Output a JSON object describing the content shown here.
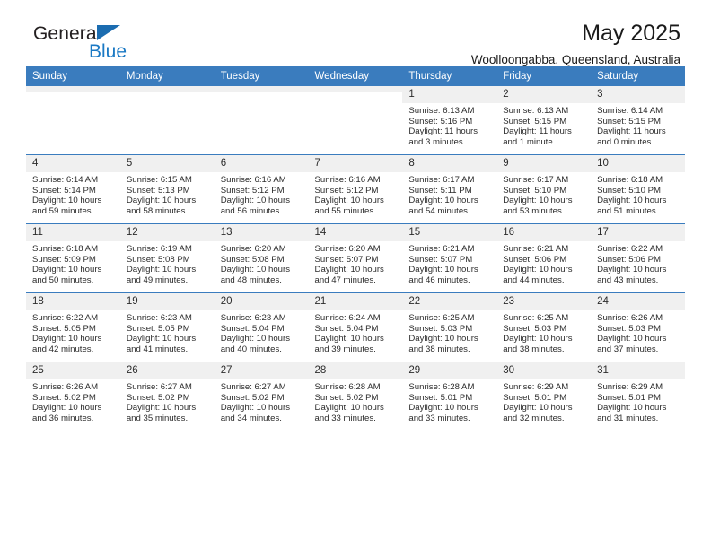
{
  "brand": {
    "name_top": "General",
    "name_bottom": "Blue",
    "triangle_color": "#1b6cb0",
    "blue_color": "#1b79c4"
  },
  "header": {
    "title": "May 2025",
    "subtitle": "Woolloongabba, Queensland, Australia"
  },
  "theme": {
    "header_band": "#3a7cbe",
    "daynum_band": "#f0f0f0",
    "text": "#2b2b2b"
  },
  "labels": {
    "sunrise": "Sunrise:",
    "sunset": "Sunset:",
    "daylight": "Daylight:"
  },
  "weekdays": [
    "Sunday",
    "Monday",
    "Tuesday",
    "Wednesday",
    "Thursday",
    "Friday",
    "Saturday"
  ],
  "weeks": [
    [
      {
        "day": "",
        "empty": true
      },
      {
        "day": "",
        "empty": true
      },
      {
        "day": "",
        "empty": true
      },
      {
        "day": "",
        "empty": true
      },
      {
        "day": "1",
        "sunrise": "Sunrise: 6:13 AM",
        "sunset": "Sunset: 5:16 PM",
        "daylight": "Daylight: 11 hours and 3 minutes."
      },
      {
        "day": "2",
        "sunrise": "Sunrise: 6:13 AM",
        "sunset": "Sunset: 5:15 PM",
        "daylight": "Daylight: 11 hours and 1 minute."
      },
      {
        "day": "3",
        "sunrise": "Sunrise: 6:14 AM",
        "sunset": "Sunset: 5:15 PM",
        "daylight": "Daylight: 11 hours and 0 minutes."
      }
    ],
    [
      {
        "day": "4",
        "sunrise": "Sunrise: 6:14 AM",
        "sunset": "Sunset: 5:14 PM",
        "daylight": "Daylight: 10 hours and 59 minutes."
      },
      {
        "day": "5",
        "sunrise": "Sunrise: 6:15 AM",
        "sunset": "Sunset: 5:13 PM",
        "daylight": "Daylight: 10 hours and 58 minutes."
      },
      {
        "day": "6",
        "sunrise": "Sunrise: 6:16 AM",
        "sunset": "Sunset: 5:12 PM",
        "daylight": "Daylight: 10 hours and 56 minutes."
      },
      {
        "day": "7",
        "sunrise": "Sunrise: 6:16 AM",
        "sunset": "Sunset: 5:12 PM",
        "daylight": "Daylight: 10 hours and 55 minutes."
      },
      {
        "day": "8",
        "sunrise": "Sunrise: 6:17 AM",
        "sunset": "Sunset: 5:11 PM",
        "daylight": "Daylight: 10 hours and 54 minutes."
      },
      {
        "day": "9",
        "sunrise": "Sunrise: 6:17 AM",
        "sunset": "Sunset: 5:10 PM",
        "daylight": "Daylight: 10 hours and 53 minutes."
      },
      {
        "day": "10",
        "sunrise": "Sunrise: 6:18 AM",
        "sunset": "Sunset: 5:10 PM",
        "daylight": "Daylight: 10 hours and 51 minutes."
      }
    ],
    [
      {
        "day": "11",
        "sunrise": "Sunrise: 6:18 AM",
        "sunset": "Sunset: 5:09 PM",
        "daylight": "Daylight: 10 hours and 50 minutes."
      },
      {
        "day": "12",
        "sunrise": "Sunrise: 6:19 AM",
        "sunset": "Sunset: 5:08 PM",
        "daylight": "Daylight: 10 hours and 49 minutes."
      },
      {
        "day": "13",
        "sunrise": "Sunrise: 6:20 AM",
        "sunset": "Sunset: 5:08 PM",
        "daylight": "Daylight: 10 hours and 48 minutes."
      },
      {
        "day": "14",
        "sunrise": "Sunrise: 6:20 AM",
        "sunset": "Sunset: 5:07 PM",
        "daylight": "Daylight: 10 hours and 47 minutes."
      },
      {
        "day": "15",
        "sunrise": "Sunrise: 6:21 AM",
        "sunset": "Sunset: 5:07 PM",
        "daylight": "Daylight: 10 hours and 46 minutes."
      },
      {
        "day": "16",
        "sunrise": "Sunrise: 6:21 AM",
        "sunset": "Sunset: 5:06 PM",
        "daylight": "Daylight: 10 hours and 44 minutes."
      },
      {
        "day": "17",
        "sunrise": "Sunrise: 6:22 AM",
        "sunset": "Sunset: 5:06 PM",
        "daylight": "Daylight: 10 hours and 43 minutes."
      }
    ],
    [
      {
        "day": "18",
        "sunrise": "Sunrise: 6:22 AM",
        "sunset": "Sunset: 5:05 PM",
        "daylight": "Daylight: 10 hours and 42 minutes."
      },
      {
        "day": "19",
        "sunrise": "Sunrise: 6:23 AM",
        "sunset": "Sunset: 5:05 PM",
        "daylight": "Daylight: 10 hours and 41 minutes."
      },
      {
        "day": "20",
        "sunrise": "Sunrise: 6:23 AM",
        "sunset": "Sunset: 5:04 PM",
        "daylight": "Daylight: 10 hours and 40 minutes."
      },
      {
        "day": "21",
        "sunrise": "Sunrise: 6:24 AM",
        "sunset": "Sunset: 5:04 PM",
        "daylight": "Daylight: 10 hours and 39 minutes."
      },
      {
        "day": "22",
        "sunrise": "Sunrise: 6:25 AM",
        "sunset": "Sunset: 5:03 PM",
        "daylight": "Daylight: 10 hours and 38 minutes."
      },
      {
        "day": "23",
        "sunrise": "Sunrise: 6:25 AM",
        "sunset": "Sunset: 5:03 PM",
        "daylight": "Daylight: 10 hours and 38 minutes."
      },
      {
        "day": "24",
        "sunrise": "Sunrise: 6:26 AM",
        "sunset": "Sunset: 5:03 PM",
        "daylight": "Daylight: 10 hours and 37 minutes."
      }
    ],
    [
      {
        "day": "25",
        "sunrise": "Sunrise: 6:26 AM",
        "sunset": "Sunset: 5:02 PM",
        "daylight": "Daylight: 10 hours and 36 minutes."
      },
      {
        "day": "26",
        "sunrise": "Sunrise: 6:27 AM",
        "sunset": "Sunset: 5:02 PM",
        "daylight": "Daylight: 10 hours and 35 minutes."
      },
      {
        "day": "27",
        "sunrise": "Sunrise: 6:27 AM",
        "sunset": "Sunset: 5:02 PM",
        "daylight": "Daylight: 10 hours and 34 minutes."
      },
      {
        "day": "28",
        "sunrise": "Sunrise: 6:28 AM",
        "sunset": "Sunset: 5:02 PM",
        "daylight": "Daylight: 10 hours and 33 minutes."
      },
      {
        "day": "29",
        "sunrise": "Sunrise: 6:28 AM",
        "sunset": "Sunset: 5:01 PM",
        "daylight": "Daylight: 10 hours and 33 minutes."
      },
      {
        "day": "30",
        "sunrise": "Sunrise: 6:29 AM",
        "sunset": "Sunset: 5:01 PM",
        "daylight": "Daylight: 10 hours and 32 minutes."
      },
      {
        "day": "31",
        "sunrise": "Sunrise: 6:29 AM",
        "sunset": "Sunset: 5:01 PM",
        "daylight": "Daylight: 10 hours and 31 minutes."
      }
    ]
  ]
}
